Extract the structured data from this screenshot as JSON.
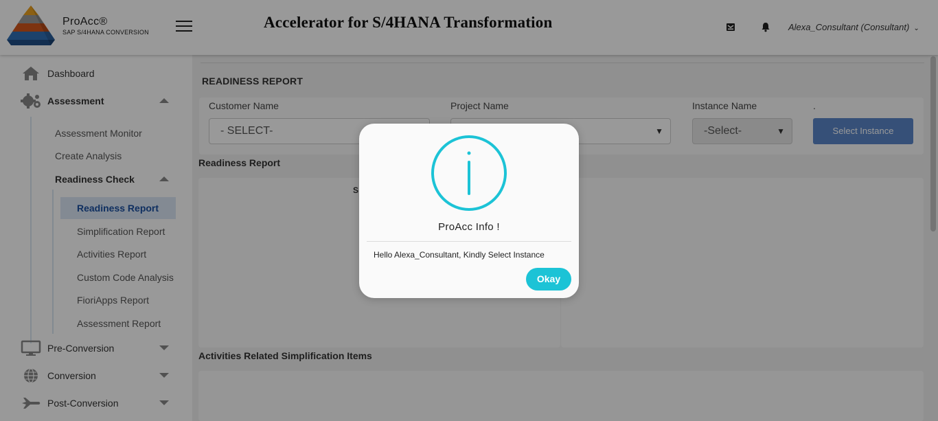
{
  "header": {
    "brand_name": "ProAcc®",
    "brand_sub": "SAP S/4HANA CONVERSION",
    "title": "Accelerator for S/4HANA Transformation",
    "user": "Alexa_Consultant (Consultant)",
    "icons": [
      "menu-icon",
      "mail-icon",
      "bell-icon",
      "chevron-down-icon"
    ]
  },
  "sidebar": {
    "dashboard": "Dashboard",
    "assessment": "Assessment",
    "assessment_items": [
      "Assessment Monitor",
      "Create Analysis",
      "Readiness Check"
    ],
    "readiness_items": [
      "Readiness Report",
      "Simplification Report",
      "Activities Report",
      "Custom Code Analysis",
      "FioriApps Report",
      "Assessment Report"
    ],
    "pre_conversion": "Pre-Conversion",
    "conversion": "Conversion",
    "post_conversion": "Post-Conversion"
  },
  "main": {
    "section_title": "READINESS REPORT",
    "customer_label": "Customer Name",
    "customer_value": "- SELECT-",
    "project_label": "Project Name",
    "project_value": "",
    "instance_label": "Instance Name",
    "instance_value": "-Select-",
    "dot": ".",
    "select_instance_button": "Select Instance",
    "readiness_subtitle": "Readiness Report",
    "panel_clipped_text": "S",
    "activities_subtitle": "Activities Related Simplification Items"
  },
  "modal": {
    "title": "ProAcc Info !",
    "message": "Hello Alexa_Consultant, Kindly Select Instance",
    "ok_button": "Okay"
  },
  "colors": {
    "accent": "#1cc3d6",
    "button_blue": "#5b86c9",
    "active_nav_text": "#1a4fa0",
    "active_nav_bg": "#dbe7f6"
  }
}
